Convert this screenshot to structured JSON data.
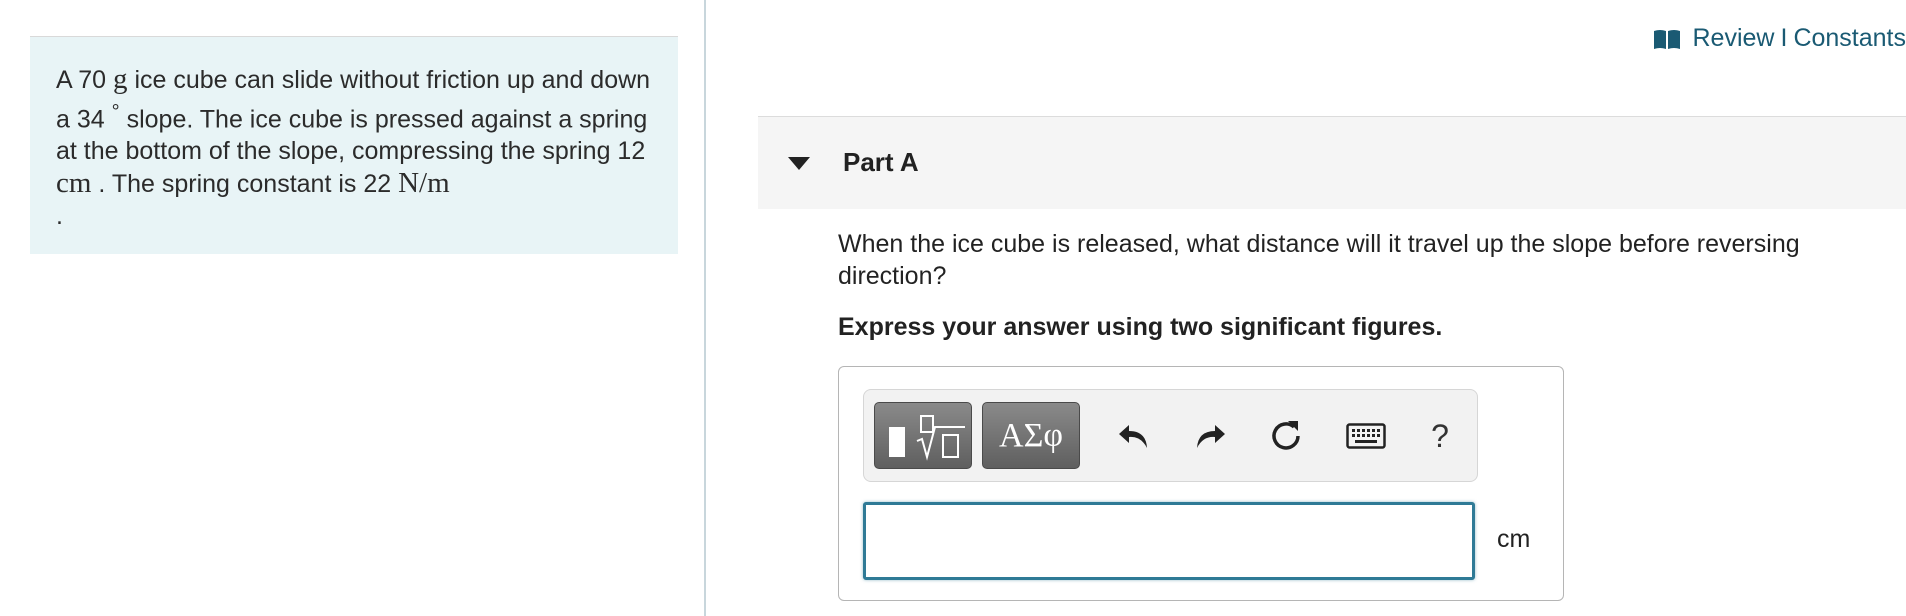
{
  "header": {
    "review_link": "Review",
    "separator": "I",
    "constants_link": "Constants"
  },
  "problem": {
    "text_1": "A 70",
    "mass_unit": "g",
    "text_2": "ice cube can slide without friction up and down a 34",
    "degree_symbol": "°",
    "text_3": "slope. The ice cube is pressed against a spring at the bottom of the slope, compressing the spring 12",
    "length_unit": "cm",
    "text_4": ". The spring constant is 22",
    "k_unit": "N/m",
    "text_5": "."
  },
  "part": {
    "title": "Part A",
    "question": "When the ice cube is released, what distance will it travel up the slope before reversing direction?",
    "instruction": "Express your answer using two significant figures."
  },
  "toolbar": {
    "greek_label": "ΑΣφ",
    "help_label": "?"
  },
  "answer": {
    "value": "",
    "unit": "cm"
  },
  "colors": {
    "link": "#1a5a73",
    "problem_bg": "#e8f4f6",
    "input_border": "#2f7a96"
  }
}
